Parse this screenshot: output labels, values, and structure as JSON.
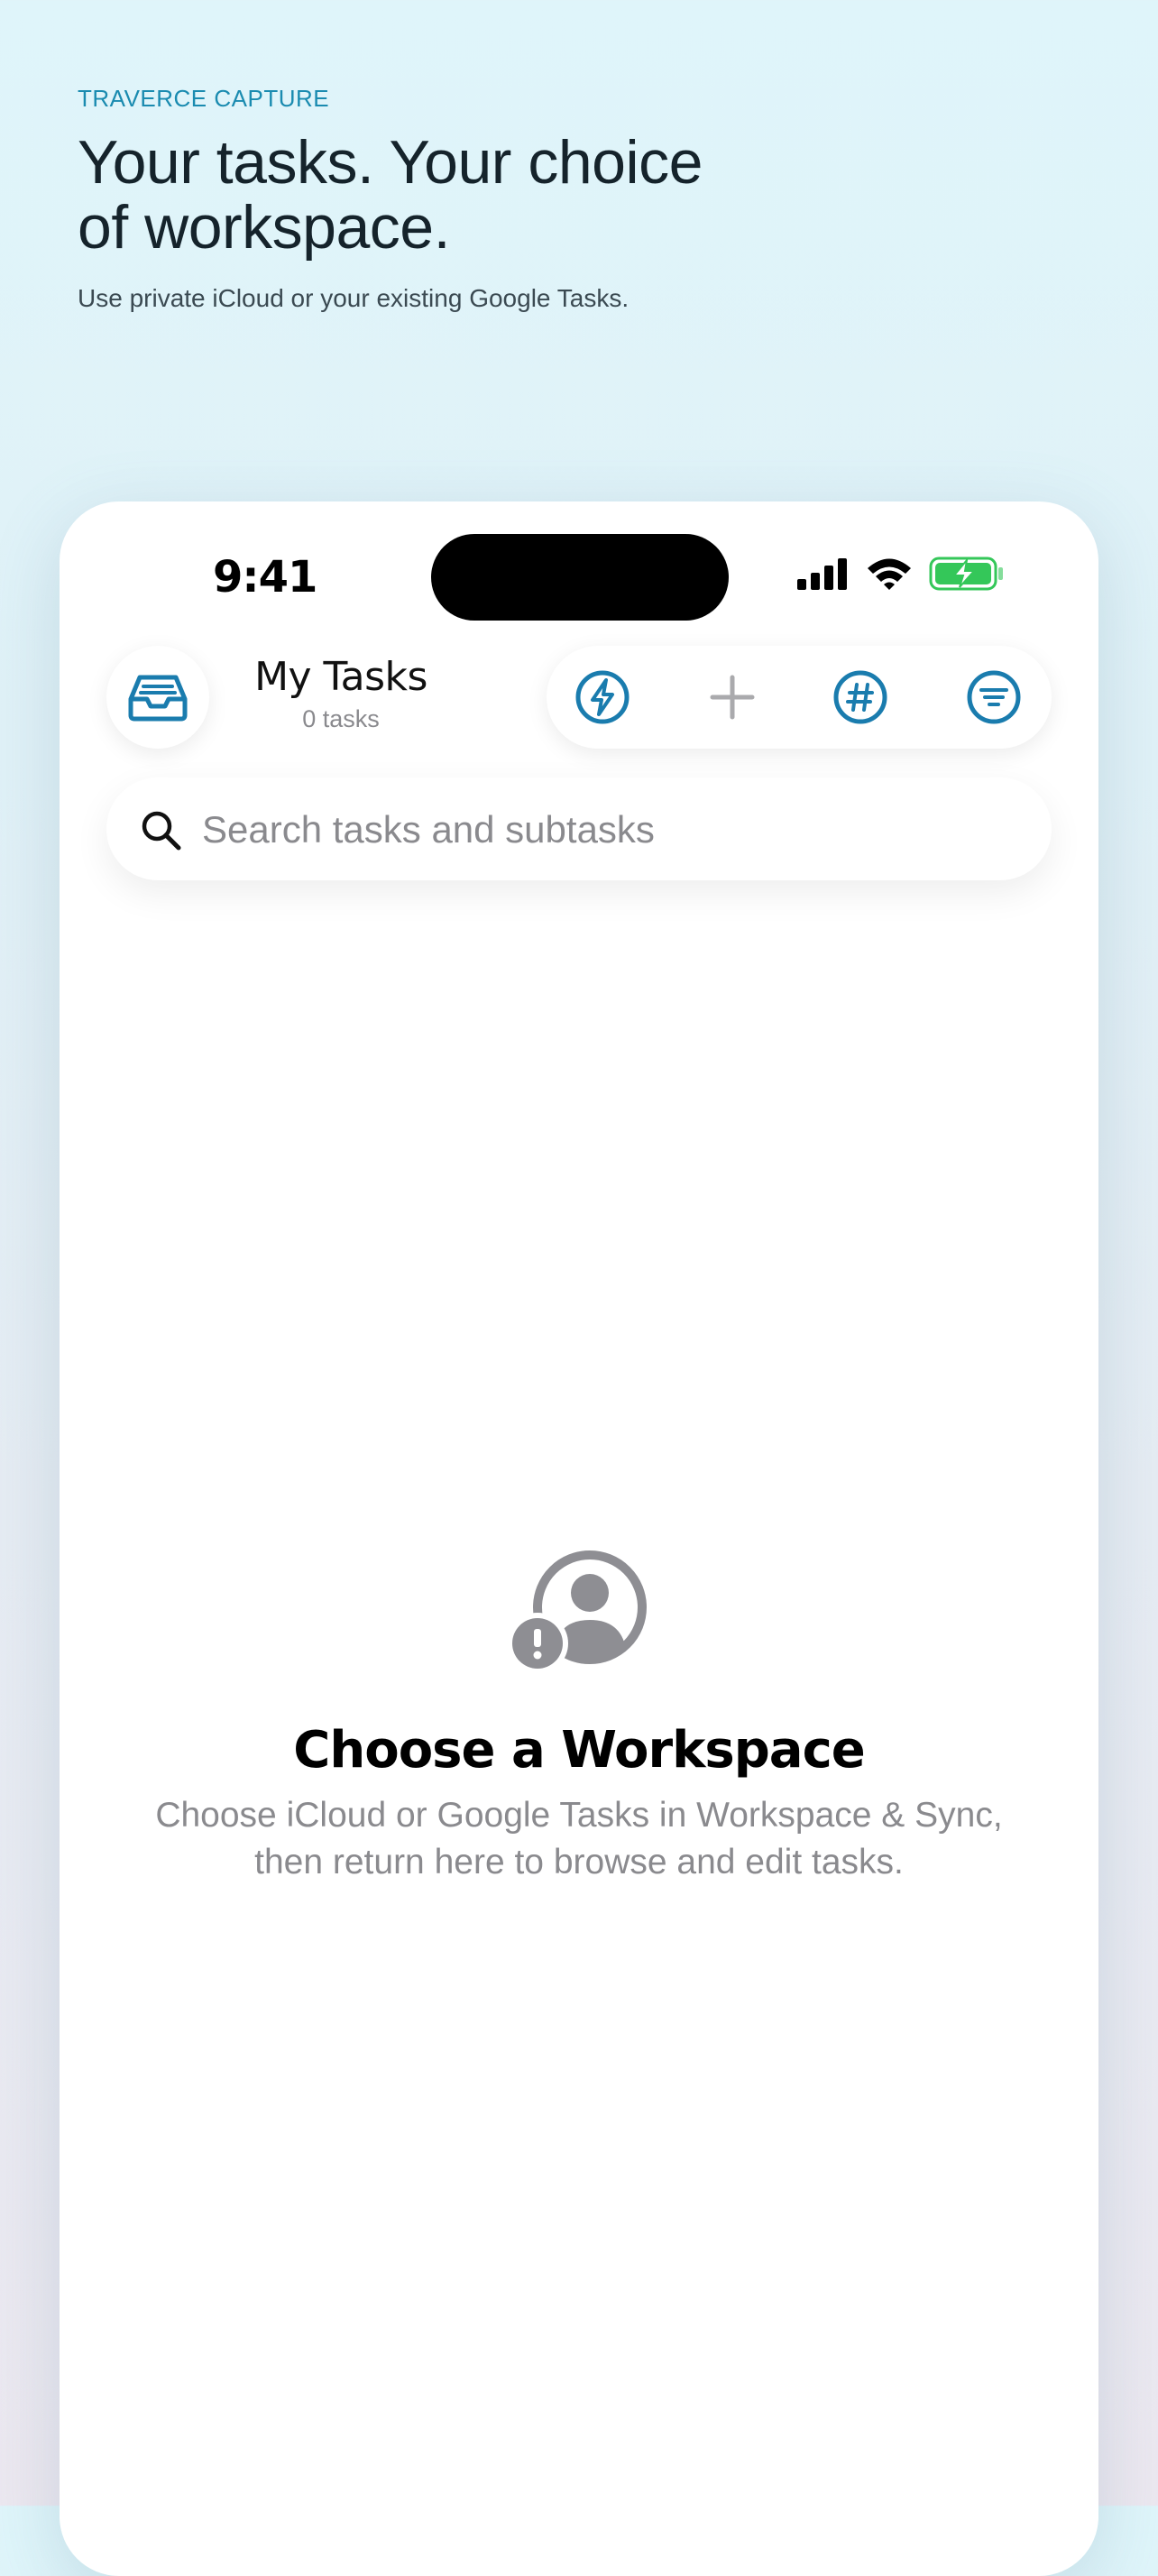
{
  "marketing": {
    "eyebrow": "TRAVERCE CAPTURE",
    "headline_line1": "Your tasks. Your choice",
    "headline_line2": "of workspace.",
    "subhead": "Use private iCloud or your existing Google Tasks."
  },
  "status_bar": {
    "time": "9:41",
    "icons": [
      "cellular-signal-icon",
      "wifi-icon",
      "battery-charging-icon"
    ],
    "battery_color": "#34c759"
  },
  "header": {
    "title": "My Tasks",
    "count": "0 tasks",
    "left_button_icon": "inbox-tray-icon",
    "toolbar_icons": [
      "bolt-icon",
      "plus-icon",
      "hashtag-icon",
      "filter-icon"
    ]
  },
  "search": {
    "placeholder": "Search tasks and subtasks"
  },
  "empty_state": {
    "icon": "person-warning-icon",
    "title": "Choose a Workspace",
    "body_line1": "Choose iCloud or Google Tasks in Workspace & Sync,",
    "body_line2": "then return here to browse and edit tasks."
  },
  "colors": {
    "accent": "#1a7cae",
    "eyebrow": "#1a8bb0",
    "muted": "#8a8a8e"
  }
}
